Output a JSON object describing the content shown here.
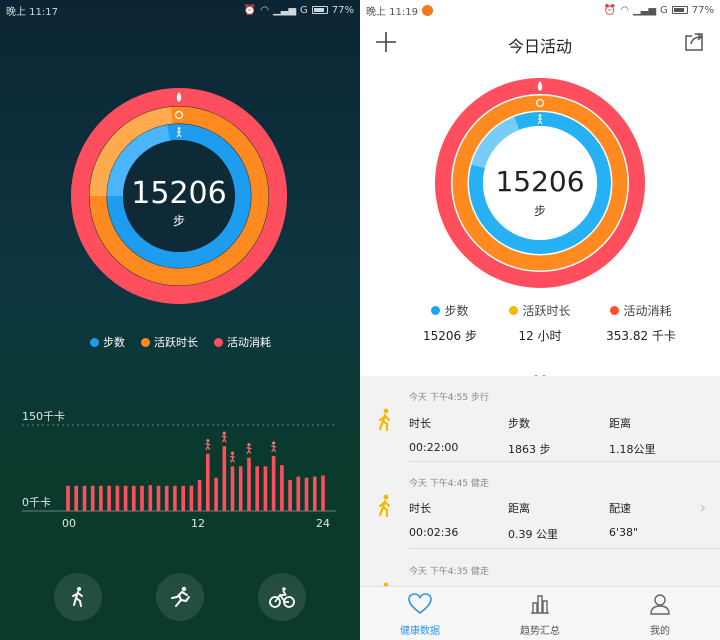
{
  "left": {
    "status": {
      "time": "晚上 11:17",
      "network": "G",
      "battery": "77%"
    },
    "center": {
      "value": "15206",
      "unit": "步"
    },
    "legend": [
      {
        "label": "步数",
        "color": "#1e9cf0"
      },
      {
        "label": "活跃时长",
        "color": "#ff8a1f"
      },
      {
        "label": "活动消耗",
        "color": "#ff4f5e"
      }
    ],
    "chart": {
      "y_top_label": "150千卡",
      "y_bottom_label": "0千卡",
      "x_labels": [
        "00",
        "12",
        "24"
      ]
    },
    "buttons": [
      {
        "icon": "walk-icon"
      },
      {
        "icon": "run-icon"
      },
      {
        "icon": "cycle-icon"
      }
    ]
  },
  "right": {
    "status": {
      "time": "晚上 11:19",
      "network": "G",
      "battery": "77%"
    },
    "title": "今日活动",
    "center": {
      "value": "15206",
      "unit": "步"
    },
    "stats": [
      {
        "label": "步数",
        "value": "15206 步",
        "color": "#1aa6f0"
      },
      {
        "label": "活跃时长",
        "value": "12 小时",
        "color": "#f5b800"
      },
      {
        "label": "活动消耗",
        "value": "353.82 千卡",
        "color": "#ff4f2e"
      }
    ],
    "records": [
      {
        "header": "今天 下午4:55 步行",
        "cols": [
          {
            "label": "时长",
            "value": "00:22:00"
          },
          {
            "label": "步数",
            "value": "1863 步"
          },
          {
            "label": "距离",
            "value": "1.18公里"
          }
        ]
      },
      {
        "header": "今天 下午4:45 健走",
        "cols": [
          {
            "label": "时长",
            "value": "00:02:36"
          },
          {
            "label": "距离",
            "value": "0.39 公里"
          },
          {
            "label": "配速",
            "value": "6'38\""
          }
        ]
      },
      {
        "header": "今天 下午4:35 健走",
        "cols": []
      }
    ],
    "tabs": [
      {
        "label": "健康数据",
        "icon": "heart-icon",
        "active": true
      },
      {
        "label": "趋势汇总",
        "icon": "bar-chart-icon",
        "active": false
      },
      {
        "label": "我的",
        "icon": "person-icon",
        "active": false
      }
    ]
  },
  "chart_data": {
    "type": "bar",
    "xlabel": "",
    "ylabel": "",
    "x_ticks": [
      "00",
      "12",
      "24"
    ],
    "ylim": [
      0,
      150
    ],
    "y_ticks": [
      "0千卡",
      "150千卡"
    ],
    "values": [
      44,
      44,
      44,
      44,
      44,
      44,
      44,
      44,
      44,
      44,
      45,
      44,
      44,
      44,
      44,
      44,
      54,
      100,
      58,
      113,
      78,
      78,
      93,
      78,
      78,
      96,
      80,
      54,
      60,
      58,
      60,
      62
    ]
  }
}
